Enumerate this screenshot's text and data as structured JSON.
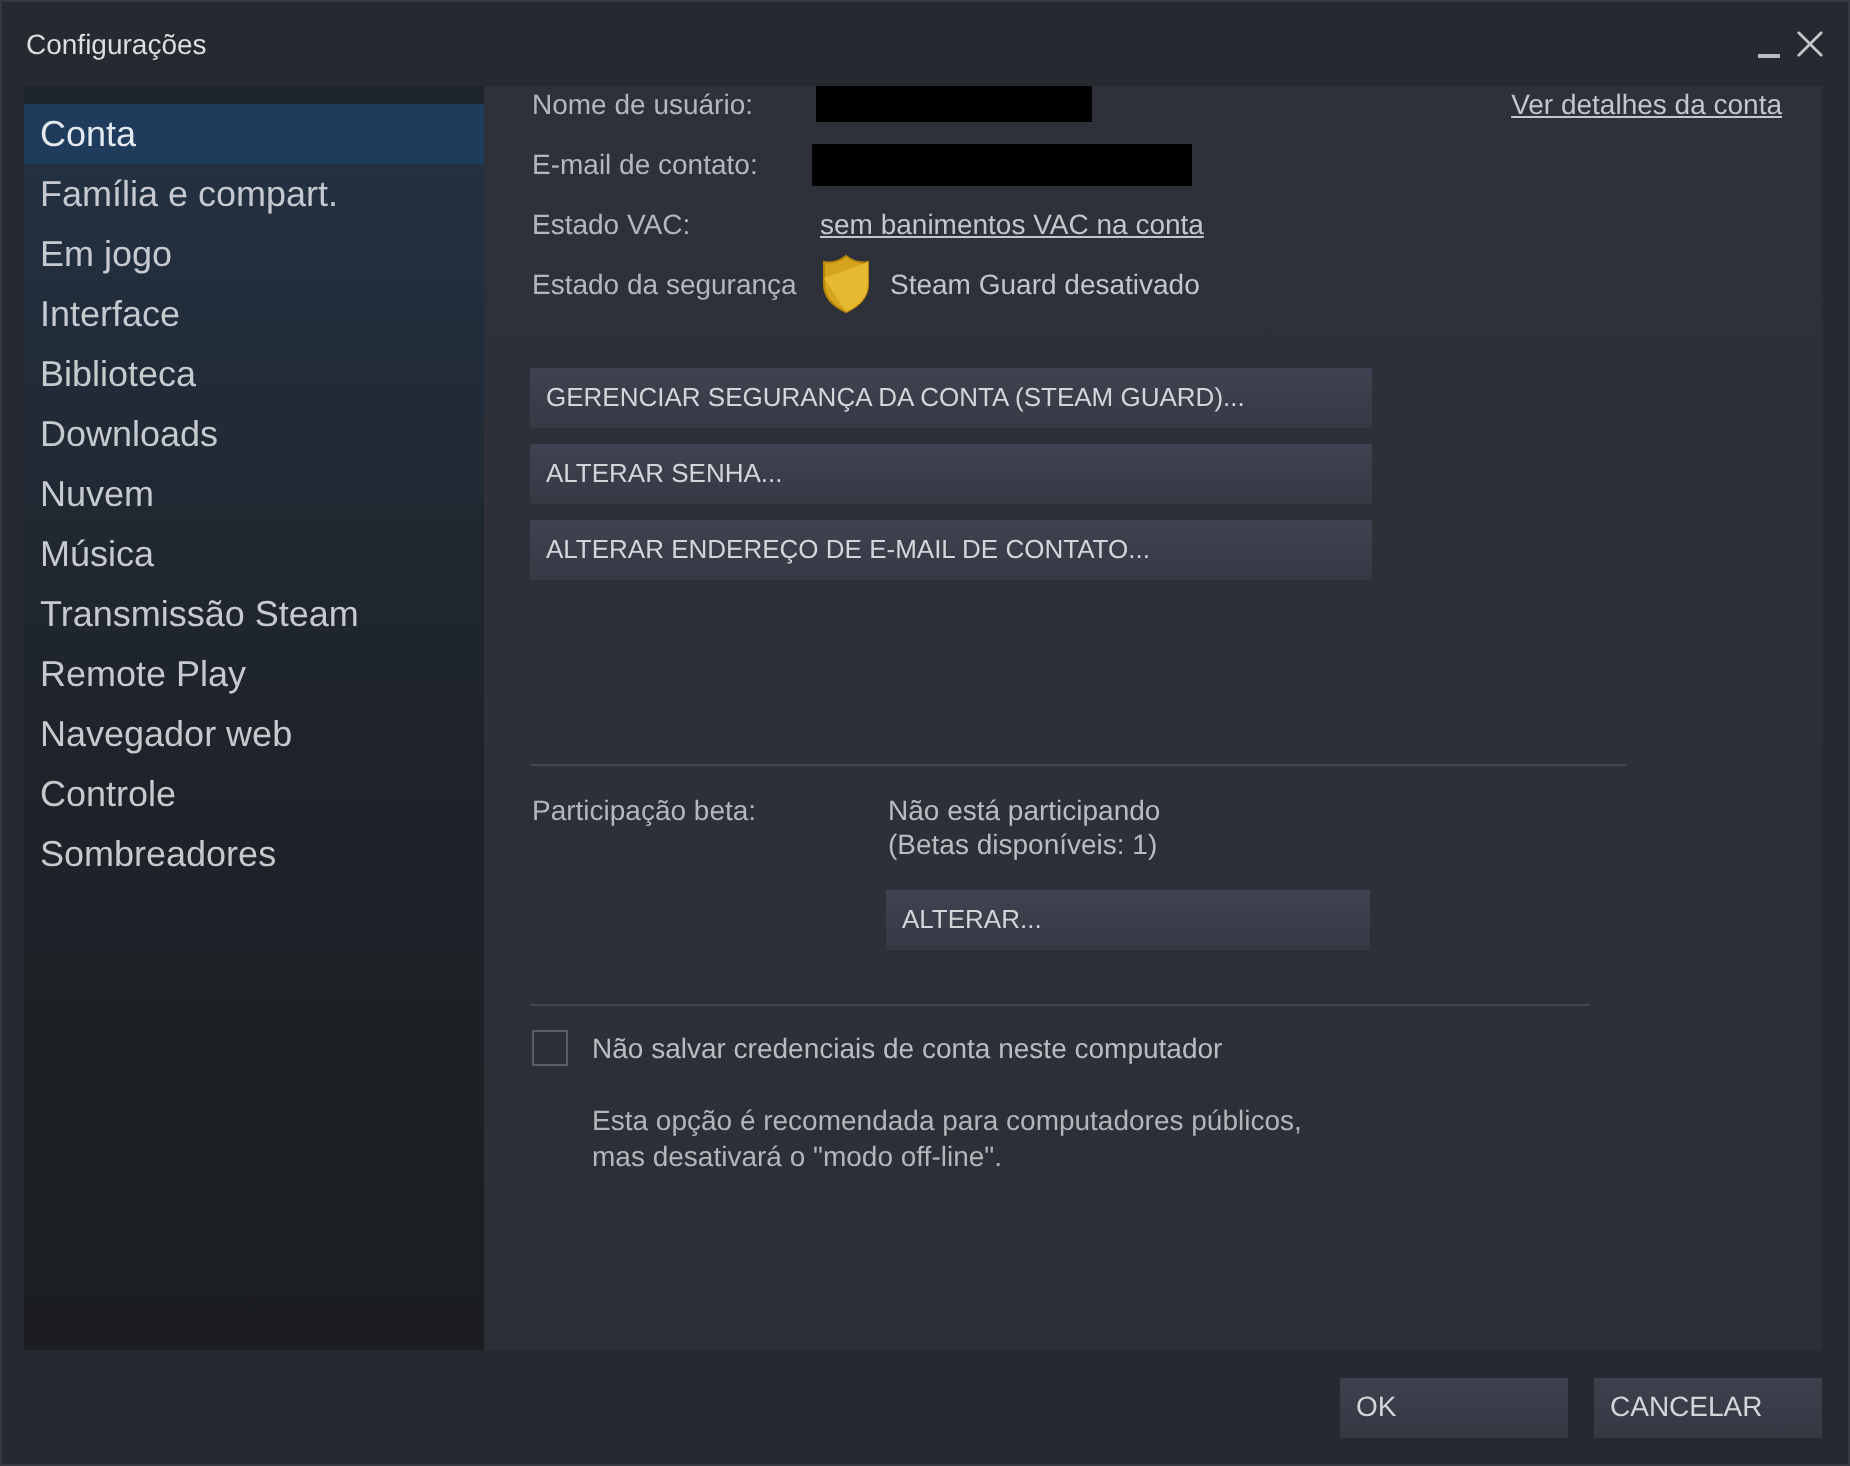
{
  "window": {
    "title": "Configurações"
  },
  "sidebar": {
    "items": [
      {
        "label": "Conta",
        "selected": true
      },
      {
        "label": "Família e compart.",
        "selected": false
      },
      {
        "label": "Em jogo",
        "selected": false
      },
      {
        "label": "Interface",
        "selected": false
      },
      {
        "label": "Biblioteca",
        "selected": false
      },
      {
        "label": "Downloads",
        "selected": false
      },
      {
        "label": "Nuvem",
        "selected": false
      },
      {
        "label": "Música",
        "selected": false
      },
      {
        "label": "Transmissão Steam",
        "selected": false
      },
      {
        "label": "Remote Play",
        "selected": false
      },
      {
        "label": "Navegador web",
        "selected": false
      },
      {
        "label": "Controle",
        "selected": false
      },
      {
        "label": "Sombreadores",
        "selected": false
      }
    ]
  },
  "account": {
    "fields": [
      {
        "kind": "redacted",
        "label": "Nome de usuário:"
      },
      {
        "kind": "redacted",
        "label": "E-mail de contato:"
      },
      {
        "kind": "link",
        "label": "Estado VAC:",
        "value": "sem banimentos VAC na conta"
      },
      {
        "kind": "status",
        "label": "Estado da segurança",
        "value": "Steam Guard desativado"
      }
    ],
    "details_link": "Ver detalhes da conta",
    "buttons": [
      "GERENCIAR SEGURANÇA DA CONTA (STEAM GUARD)...",
      "ALTERAR SENHA...",
      "ALTERAR ENDEREÇO DE E-MAIL DE CONTATO..."
    ]
  },
  "beta": {
    "label": "Participação beta:",
    "status": [
      "Não está participando",
      "(Betas disponíveis: 1)"
    ],
    "button": "ALTERAR..."
  },
  "credentials": {
    "label": "Não salvar credenciais de conta neste computador",
    "checked": false,
    "note": "Esta opção é recomendada para computadores públicos,\nmas desativará o \"modo off-line\"."
  },
  "footer": {
    "buttons": [
      "OK",
      "CANCELAR"
    ]
  }
}
